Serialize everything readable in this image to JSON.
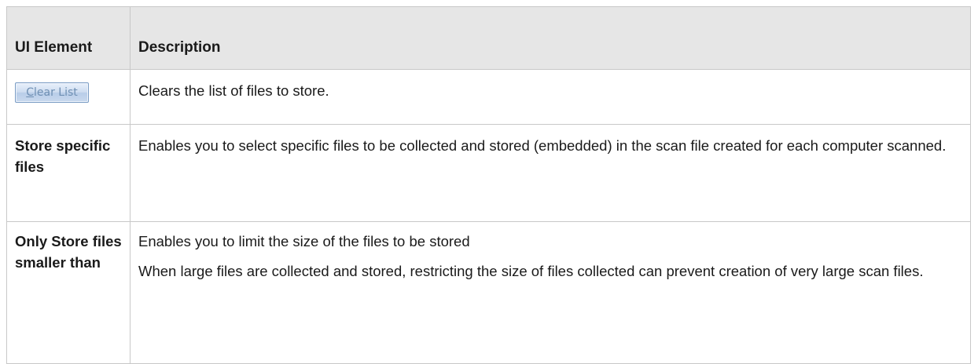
{
  "table": {
    "headers": {
      "element": "UI Element",
      "description": "Description"
    },
    "rows": [
      {
        "element_button": {
          "mnemonic": "C",
          "rest": "lear List",
          "icon": "clear-list-button-image"
        },
        "description": [
          "Clears the list of files to store."
        ]
      },
      {
        "element": "Store specific files",
        "description": [
          "Enables you to select specific files to be collected and stored (embedded) in the scan file created for each computer scanned."
        ]
      },
      {
        "element": "Only Store files smaller than",
        "description": [
          "Enables you to limit the size of the files to be stored",
          "When large files are collected and stored, restricting the size of files collected can prevent creation of very large scan files."
        ]
      }
    ]
  }
}
